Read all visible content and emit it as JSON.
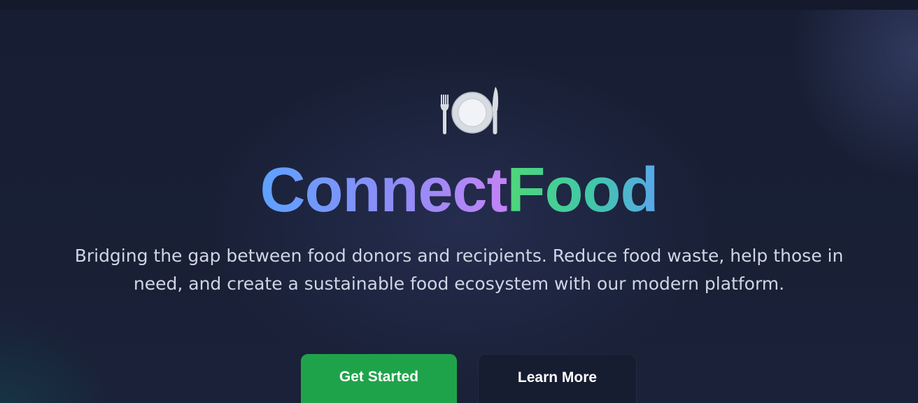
{
  "brand": {
    "name_part1": "Connect",
    "name_part2": "Food",
    "logo_icon": "plate-fork-knife-icon"
  },
  "hero": {
    "tagline": "Bridging the gap between food donors and recipients. Reduce food waste, help those in need, and create a sustainable food ecosystem with our modern platform.",
    "primary_button_label": "Get Started",
    "secondary_button_label": "Learn More"
  },
  "colors": {
    "background": "#161d31",
    "primary_button": "#1fa34a",
    "brand_gradient_start": "#5ea1ff",
    "brand_gradient_mid": "#c383f5",
    "brand_accent_green": "#4fd67a"
  }
}
